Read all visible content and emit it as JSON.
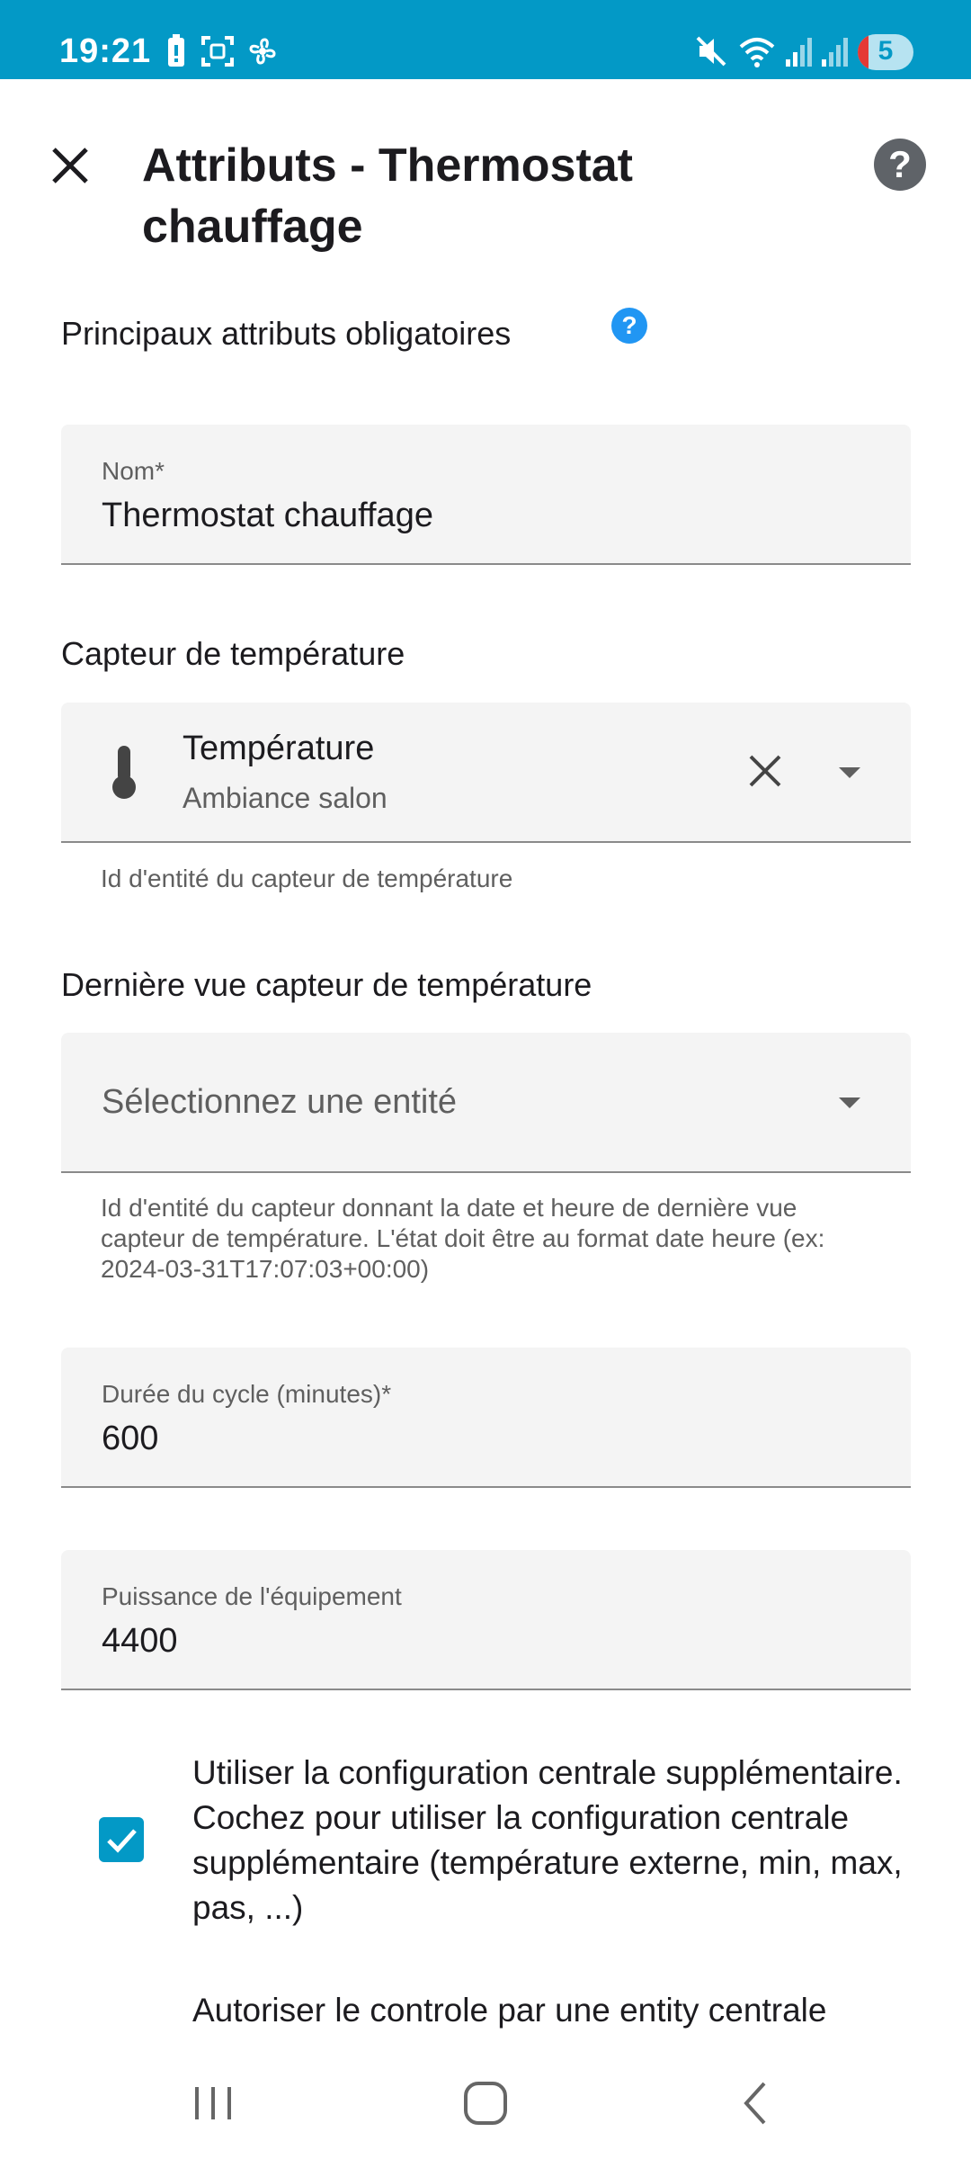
{
  "status_bar": {
    "time": "19:21",
    "battery_level": "5"
  },
  "header": {
    "title": "Attributs - Thermostat chauffage",
    "close_icon": "close-icon",
    "help_icon": "help-icon"
  },
  "section_main": {
    "label": "Principaux attributs obligatoires"
  },
  "name_field": {
    "label": "Nom*",
    "value": "Thermostat chauffage"
  },
  "temp_sensor": {
    "section_label": "Capteur de température",
    "entity_name": "Température",
    "entity_area": "Ambiance salon",
    "helper": "Id d'entité du capteur de température"
  },
  "last_seen": {
    "section_label": "Dernière vue capteur de température",
    "placeholder": "Sélectionnez une entité",
    "helper": "Id d'entité du capteur donnant la date et heure de dernière vue capteur de température. L'état doit être au format date heure (ex: 2024-03-31T17:07:03+00:00)"
  },
  "cycle_field": {
    "label": "Durée du cycle (minutes)*",
    "value": "600"
  },
  "power_field": {
    "label": "Puissance de l'équipement",
    "value": "4400"
  },
  "central_config": {
    "checked": true,
    "label": "Utiliser la configuration centrale supplémentaire. Cochez pour utiliser la configuration centrale supplémentaire (température externe, min, max, pas, ...)"
  },
  "central_control": {
    "label": "Autoriser le controle par une entity centrale"
  },
  "colors": {
    "accent": "#0399c6",
    "info": "#2196f3",
    "field_bg": "#f4f4f4"
  }
}
